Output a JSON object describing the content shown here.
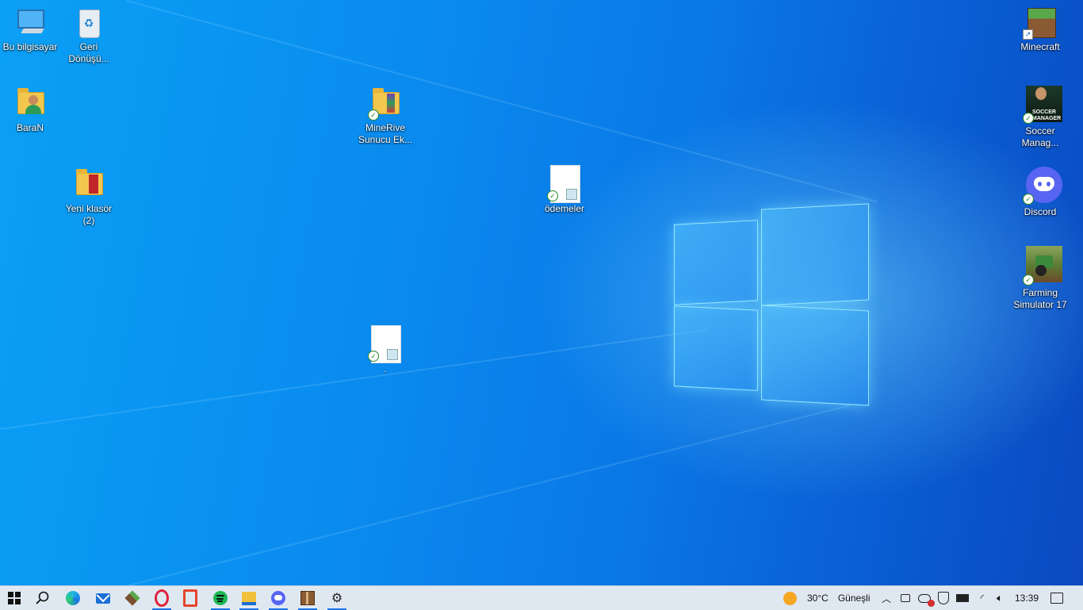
{
  "desktop": {
    "icons": [
      {
        "label": "Bu bilgisayar",
        "kind": "computer"
      },
      {
        "label": "Geri\nDönüşü...",
        "kind": "recycle"
      },
      {
        "label": "BaraN",
        "kind": "user-folder"
      },
      {
        "label": "Yeni klasör\n(2)",
        "kind": "folder"
      },
      {
        "label": "MineRive\nSunucu Ek...",
        "kind": "folder"
      },
      {
        "label": "ödemeler",
        "kind": "document"
      },
      {
        "label": ".",
        "kind": "document"
      },
      {
        "label": "Minecraft",
        "kind": "app"
      },
      {
        "label": "Soccer\nManag...",
        "kind": "app"
      },
      {
        "label": "Discord",
        "kind": "app"
      },
      {
        "label": "Farming\nSimulator 17",
        "kind": "app"
      }
    ]
  },
  "taskbar": {
    "apps": [
      {
        "name": "start-button"
      },
      {
        "name": "search"
      },
      {
        "name": "edge"
      },
      {
        "name": "mail"
      },
      {
        "name": "minecraft"
      },
      {
        "name": "opera"
      },
      {
        "name": "office"
      },
      {
        "name": "spotify"
      },
      {
        "name": "file-explorer"
      },
      {
        "name": "discord"
      },
      {
        "name": "package-app"
      },
      {
        "name": "settings"
      }
    ],
    "weather": {
      "temp": "30°C",
      "condition": "Güneşli"
    },
    "clock": "13:39"
  },
  "colors": {
    "accent": "#1a73e8",
    "taskbar_bg": "#dfe8f1"
  }
}
